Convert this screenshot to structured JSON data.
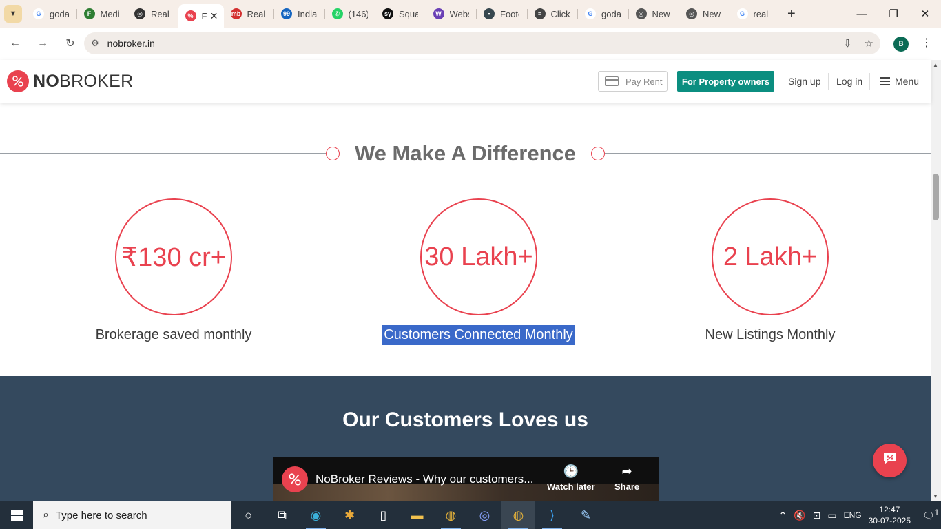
{
  "browser": {
    "tabs": [
      {
        "label": "goda",
        "fav_color": "#ffffff",
        "fav_text": "G",
        "fav_fg": "#4285f4"
      },
      {
        "label": "Medi",
        "fav_color": "#2e7d32",
        "fav_text": "F",
        "fav_fg": "#ffffff"
      },
      {
        "label": "Real",
        "fav_color": "#333333",
        "fav_text": "◎",
        "fav_fg": "#ffffff"
      },
      {
        "label": "F",
        "fav_color": "#e9424f",
        "fav_text": "%",
        "fav_fg": "#ffffff",
        "active": true
      },
      {
        "label": "Real",
        "fav_color": "#d32f2f",
        "fav_text": "mb",
        "fav_fg": "#ffffff"
      },
      {
        "label": "India",
        "fav_color": "#1565c0",
        "fav_text": "99",
        "fav_fg": "#ffffff"
      },
      {
        "label": "(146)",
        "fav_color": "#25d366",
        "fav_text": "✆",
        "fav_fg": "#ffffff"
      },
      {
        "label": "Squa",
        "fav_color": "#111111",
        "fav_text": "sy",
        "fav_fg": "#ffffff"
      },
      {
        "label": "Webs",
        "fav_color": "#6a3fb5",
        "fav_text": "W",
        "fav_fg": "#ffffff"
      },
      {
        "label": "Foote",
        "fav_color": "#37474f",
        "fav_text": "▪",
        "fav_fg": "#ffffff"
      },
      {
        "label": "Click",
        "fav_color": "#444444",
        "fav_text": "≡",
        "fav_fg": "#ffffff"
      },
      {
        "label": "goda",
        "fav_color": "#ffffff",
        "fav_text": "G",
        "fav_fg": "#4285f4"
      },
      {
        "label": "New",
        "fav_color": "#555555",
        "fav_text": "◎",
        "fav_fg": "#ffffff"
      },
      {
        "label": "New",
        "fav_color": "#555555",
        "fav_text": "◎",
        "fav_fg": "#ffffff"
      },
      {
        "label": "real",
        "fav_color": "#ffffff",
        "fav_text": "G",
        "fav_fg": "#4285f4"
      }
    ],
    "url": "nobroker.in",
    "profile_initial": "B"
  },
  "header": {
    "logo_bold": "NO",
    "logo_rest": "BROKER",
    "pay_rent": "Pay Rent",
    "owners_button": "For Property owners",
    "sign_up": "Sign up",
    "log_in": "Log in",
    "menu": "Menu"
  },
  "stats": {
    "title": "We Make A Difference",
    "items": [
      {
        "value": "₹130 cr+",
        "label": "Brokerage saved monthly"
      },
      {
        "value": "30 Lakh+",
        "label": "Customers Connected Monthly"
      },
      {
        "value": "2 Lakh+",
        "label": "New Listings Monthly"
      }
    ]
  },
  "reviews": {
    "title": "Our Customers Loves us",
    "video_title": "NoBroker Reviews - Why our customers...",
    "watch_later": "Watch later",
    "share": "Share"
  },
  "taskbar": {
    "search_placeholder": "Type here to search",
    "language": "ENG",
    "time": "12:47",
    "date": "30-07-2025",
    "notification_count": "1"
  },
  "colors": {
    "brand": "#e9424f",
    "teal": "#0b8e80",
    "reviews_bg": "#34495e",
    "selection": "#3a69c9"
  }
}
